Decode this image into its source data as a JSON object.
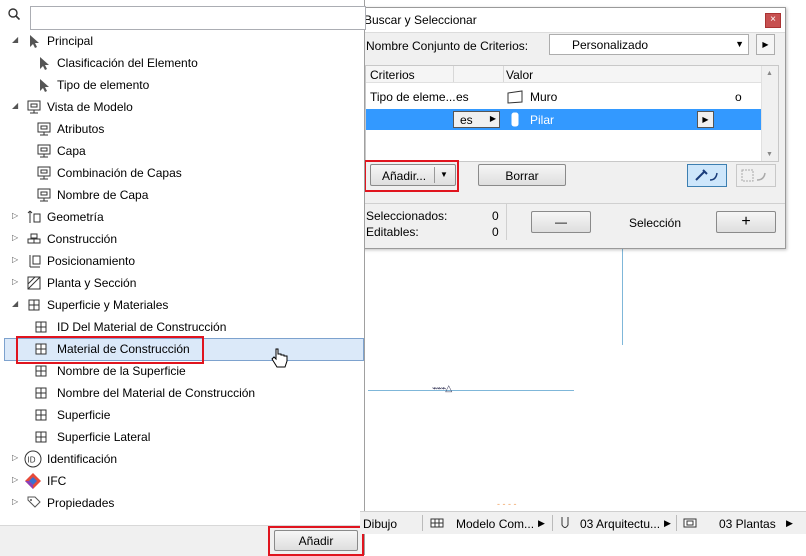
{
  "search": {
    "placeholder": ""
  },
  "tree": {
    "items": [
      {
        "label": "Principal"
      },
      {
        "label": "Clasificación del Elemento"
      },
      {
        "label": "Tipo de elemento"
      },
      {
        "label": "Vista de Modelo"
      },
      {
        "label": "Atributos"
      },
      {
        "label": "Capa"
      },
      {
        "label": "Combinación de Capas"
      },
      {
        "label": "Nombre de Capa"
      },
      {
        "label": "Geometría"
      },
      {
        "label": "Construcción"
      },
      {
        "label": "Posicionamiento"
      },
      {
        "label": "Planta y Sección"
      },
      {
        "label": "Superficie y Materiales"
      },
      {
        "label": "ID Del Material de Construcción"
      },
      {
        "label": "Material de Construcción"
      },
      {
        "label": "Nombre de la Superficie"
      },
      {
        "label": "Nombre del Material de Construcción"
      },
      {
        "label": "Superficie"
      },
      {
        "label": "Superficie Lateral"
      },
      {
        "label": "Identificación"
      },
      {
        "label": "IFC"
      },
      {
        "label": "Propiedades"
      }
    ]
  },
  "panel_footer": {
    "add_label": "Añadir"
  },
  "dialog": {
    "title": "Buscar y Seleccionar",
    "close": "×",
    "criteria_set_label": "Nombre Conjunto de Criterios:",
    "criteria_set_value": "Personalizado",
    "table": {
      "col_criteria": "Criterios",
      "col_value": "Valor",
      "rows": [
        {
          "criterion": "Tipo de eleme...",
          "op": "es",
          "value": "Muro",
          "trail": "o"
        },
        {
          "criterion": "",
          "op": "es",
          "value": "Pilar",
          "trail": ""
        }
      ]
    },
    "add_button": "Añadir...",
    "delete_button": "Borrar",
    "selected_label": "Seleccionados:",
    "selected_count": "0",
    "editable_label": "Editables:",
    "editable_count": "0",
    "selection_label": "Selección",
    "minus": "—",
    "plus": "+"
  },
  "statusbar": {
    "item1": "Dibujo",
    "item2": "Modelo Com...",
    "item3": "03 Arquitectu...",
    "item4": "03 Plantas"
  },
  "colors": {
    "highlight_box": "#e0141e",
    "selection_row": "#3399ff",
    "hover_row": "#dbe9f9"
  }
}
